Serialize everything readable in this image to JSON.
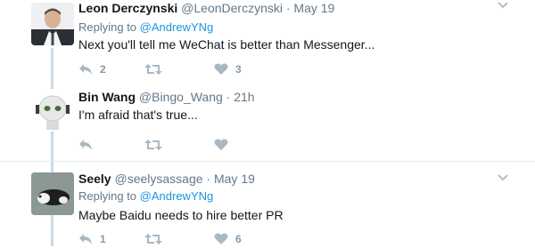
{
  "tweets": [
    {
      "name": "Leon Derczynski",
      "handle": "@LeonDerczynski",
      "sep": "·",
      "time": "May 19",
      "replying_prefix": "Replying to",
      "replying_handle": "@AndrewYNg",
      "text": "Next you'll tell me WeChat is better than Messenger...",
      "counts": {
        "reply": "2",
        "retweet": "",
        "like": "3"
      }
    },
    {
      "name": "Bin Wang",
      "handle": "@Bingo_Wang",
      "sep": "·",
      "time": "21h",
      "text": "I'm afraid that's true...",
      "counts": {
        "reply": "",
        "retweet": "",
        "like": ""
      }
    },
    {
      "name": "Seely",
      "handle": "@seelysassage",
      "sep": "·",
      "time": "May 19",
      "replying_prefix": "Replying to",
      "replying_handle": "@AndrewYNg",
      "text": "Maybe Baidu needs to hire better PR",
      "counts": {
        "reply": "1",
        "retweet": "",
        "like": "6"
      }
    }
  ],
  "colors": {
    "action_gray": "#aab8c2",
    "link_blue": "#1b95e0",
    "thread_line": "#c8dbe8",
    "divider": "#e6ecf0"
  }
}
